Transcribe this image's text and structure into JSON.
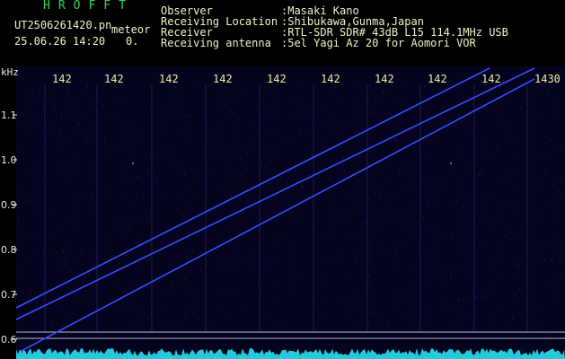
{
  "header": {
    "app_title": "HROFFT",
    "filename": "UT2506261420.pn",
    "mode_label": "meteor",
    "datetime": "25.06.26 14:20",
    "count": "0.",
    "info": [
      {
        "label": "Observer",
        "value": ":Masaki Kano"
      },
      {
        "label": "Receiving Location",
        "value": ":Shibukawa,Gunma,Japan"
      },
      {
        "label": "Receiver",
        "value": ":RTL-SDR SDR# 43dB L15 114.1MHz USB"
      },
      {
        "label": "Receiving antenna",
        "value": ":5el Yagi Az 20 for Aomori VOR"
      }
    ]
  },
  "plot": {
    "y_unit": "kHz",
    "time_labels": [
      "142",
      "142",
      "142",
      "142",
      "142",
      "142",
      "142",
      "142",
      "142",
      "1430"
    ],
    "y_ticks": [
      "1.1",
      "1.0",
      "0.9",
      "0.8",
      "0.7",
      "0.6"
    ],
    "colors": {
      "background": "#04041e",
      "trace": "#3a4cff",
      "spectrum": "#28e0f0",
      "time_labels": "#f0f0a0",
      "ref_lines": "#b8b8e0"
    }
  }
}
